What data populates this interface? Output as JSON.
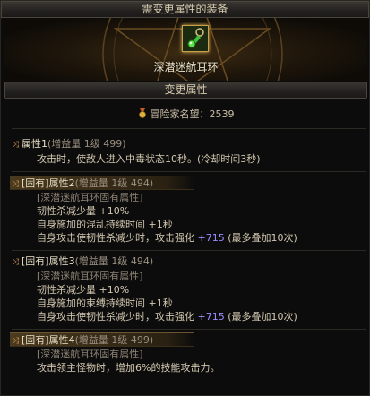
{
  "header": {
    "title": "需变更属性的装备"
  },
  "equipment": {
    "name": "深潜迷航耳环",
    "icon": "earring-item-icon"
  },
  "section": {
    "title": "变更属性"
  },
  "reputation": {
    "label": "冒险家名望：2539"
  },
  "attributes": [
    {
      "label": "属性1",
      "sub": "(增益量 1级 499)",
      "lines": [
        "攻击时，使敌人进入中毒状态10秒。(冷却时间3秒)"
      ]
    },
    {
      "label": "[固有]属性2",
      "sub": "(增益量 1级 494)",
      "bracket": "[深潜迷航耳环固有属性]",
      "lines": [
        "韧性杀减少量 +10%",
        "自身施加的混乱持续时间 +1秒"
      ],
      "last_prefix": "自身攻击使韧性杀减少时，攻击强化 ",
      "last_num": "+715",
      "last_suffix": " (最多叠加10次)"
    },
    {
      "label": "[固有]属性3",
      "sub": "(增益量 1级 494)",
      "bracket": "[深潜迷航耳环固有属性]",
      "lines": [
        "韧性杀减少量 +10%",
        "自身施加的束缚持续时间 +1秒"
      ],
      "last_prefix": "自身攻击使韧性杀减少时，攻击强化 ",
      "last_num": "+715",
      "last_suffix": " (最多叠加10次)"
    },
    {
      "label": "[固有]属性4",
      "sub": "(增益量 1级 499)",
      "bracket": "[深潜迷航耳环固有属性]",
      "lines": [
        "攻击领主怪物时，增加6%的技能攻击力。"
      ]
    }
  ],
  "colors": {
    "highlight_number": "#9a8cff",
    "gold_border": "#c9a14a"
  }
}
